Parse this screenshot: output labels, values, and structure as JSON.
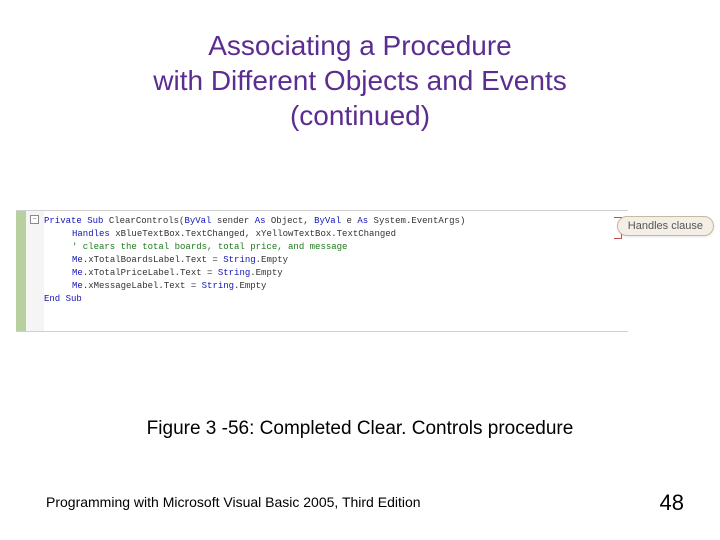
{
  "title_line1": "Associating a Procedure",
  "title_line2": "with Different Objects and Events",
  "title_line3": "(continued)",
  "code": {
    "collapse_glyph": "−",
    "line1": {
      "kw_private": "Private",
      "kw_sub": "Sub",
      "name": "ClearControls(",
      "kw_byval1": "ByVal",
      "arg1": " sender ",
      "kw_as1": "As",
      "type1": " Object, ",
      "kw_byval2": "ByVal",
      "arg2": " e ",
      "kw_as2": "As",
      "type2": " System.EventArgs)"
    },
    "line2": {
      "kw_handles": "Handles",
      "rest": " xBlueTextBox.TextChanged, xYellowTextBox.TextChanged"
    },
    "line3_comment": "' clears the total boards, total price, and message",
    "line4": {
      "kw_me": "Me",
      "mid": ".xTotalBoardsLabel.Text = ",
      "kw_string": "String",
      "tail": ".Empty"
    },
    "line5": {
      "kw_me": "Me",
      "mid": ".xTotalPriceLabel.Text = ",
      "kw_string": "String",
      "tail": ".Empty"
    },
    "line6": {
      "kw_me": "Me",
      "mid": ".xMessageLabel.Text = ",
      "kw_string": "String",
      "tail": ".Empty"
    },
    "line_end": {
      "kw_end": "End",
      "kw_sub": "Sub"
    }
  },
  "annotation": "Handles clause",
  "caption": "Figure 3 -56: Completed Clear. Controls procedure",
  "footer": "Programming with Microsoft Visual Basic 2005, Third Edition",
  "page_number": "48"
}
